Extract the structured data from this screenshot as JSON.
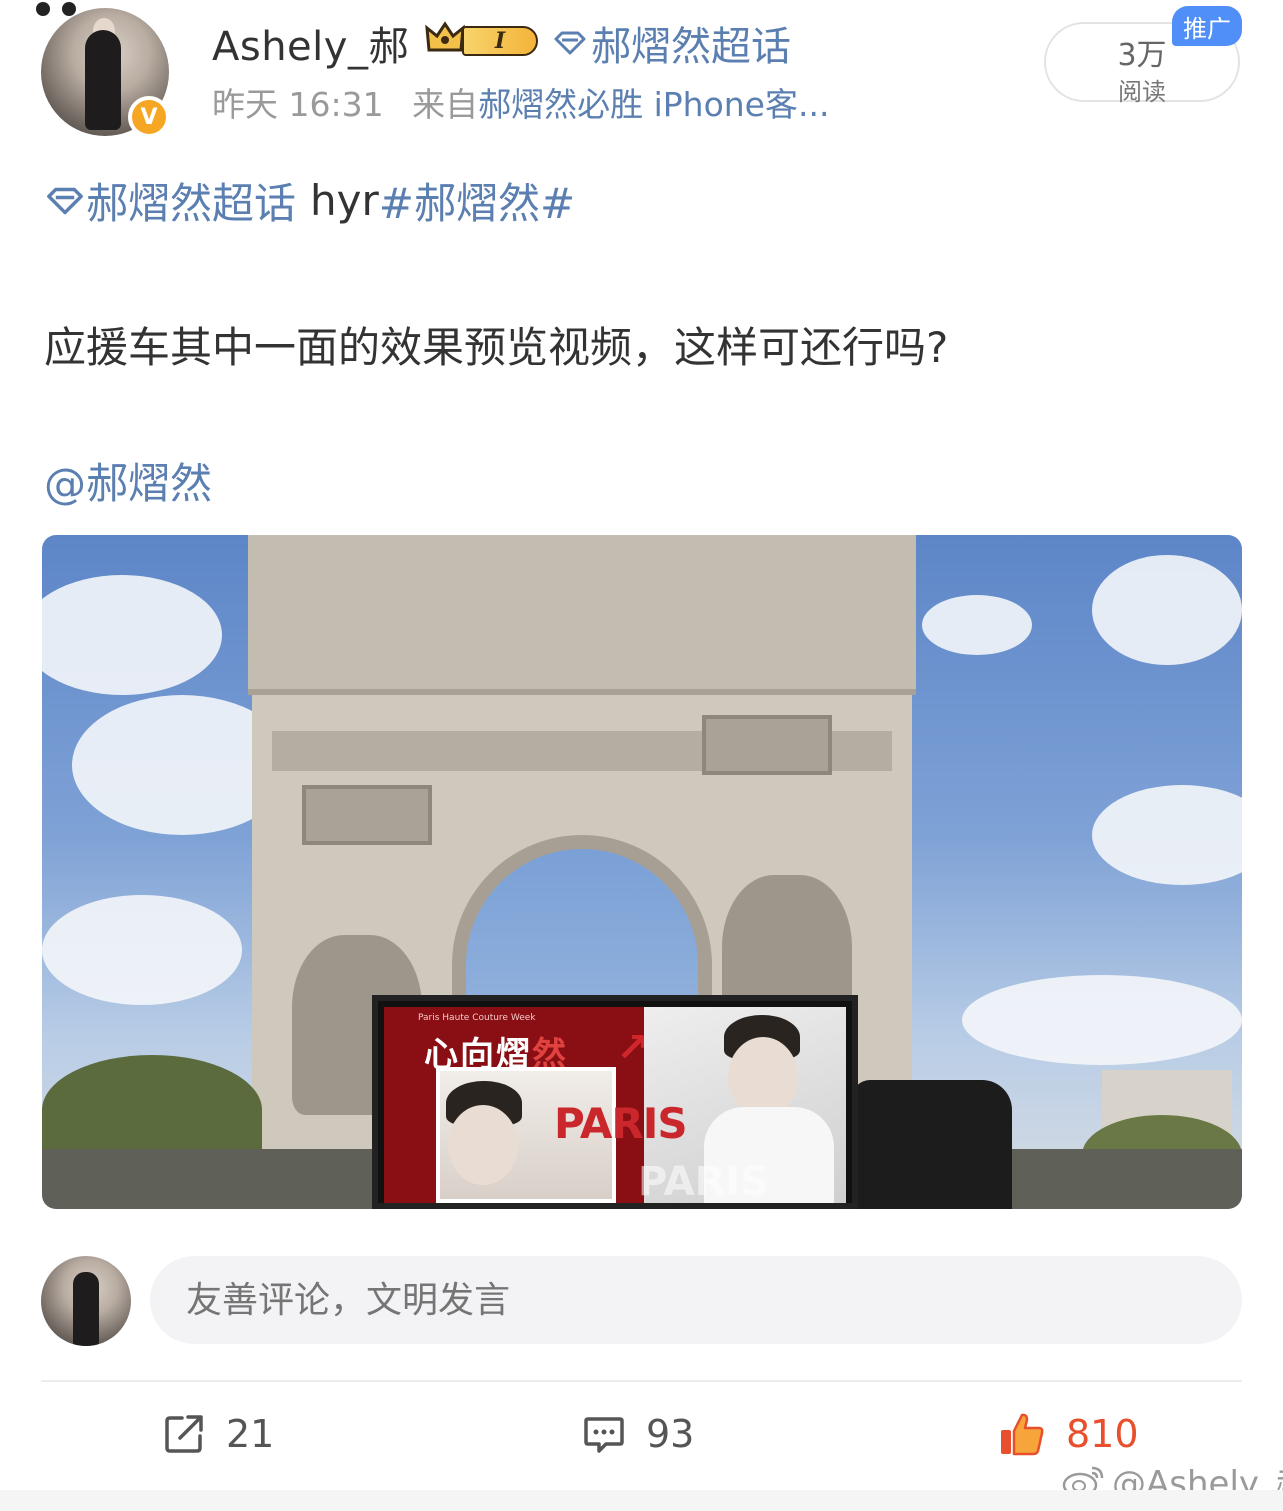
{
  "post": {
    "username": "Ashely_郝",
    "level": "I",
    "supertopic_tag": "郝熠然超话",
    "time": "昨天 16:31",
    "source_prefix": "来自",
    "source": "郝熠然必胜 iPhone客...",
    "reads_value": "3万",
    "reads_label": "阅读",
    "promo_badge": "推广",
    "topic_name": "郝熠然超话",
    "topic_suffix": "hyr",
    "hashtag": "#郝熠然#",
    "text": "应援车其中一面的效果预览视频，这样可还行吗?",
    "mention": "@郝熠然"
  },
  "media": {
    "screen_title_white": "心向熠",
    "screen_title_red": "然",
    "screen_small_text": "Paris Haute Couture Week",
    "screen_paris": "PARIS",
    "screen_paris_ghost": "PARIS",
    "arrow_glyph": "↗"
  },
  "comment": {
    "placeholder": "友善评论，文明发言"
  },
  "actions": {
    "repost_count": "21",
    "comment_count": "93",
    "like_count": "810"
  },
  "watermark": {
    "text": "@Ashely_郝"
  },
  "colors": {
    "link_blue": "#5b7fb0",
    "like_orange": "#e8502d",
    "promo_blue": "#4f8ff7",
    "verified_gold": "#f5a623"
  }
}
